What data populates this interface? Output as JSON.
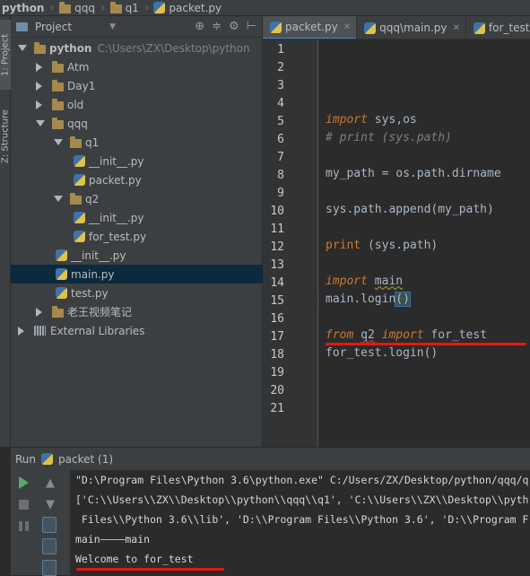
{
  "breadcrumb": {
    "items": [
      "python",
      "qqq",
      "q1",
      "packet.py"
    ]
  },
  "left_stripe": {
    "project_label": "1: Project",
    "structure_label": "Z: Structure"
  },
  "project_panel": {
    "title": "Project",
    "tree": [
      {
        "label": "python",
        "path": "C:\\Users\\ZX\\Desktop\\python",
        "type": "folder",
        "state": "open",
        "depth": 0
      },
      {
        "label": "Atm",
        "type": "folder",
        "state": "closed",
        "depth": 1
      },
      {
        "label": "Day1",
        "type": "folder",
        "state": "closed",
        "depth": 1
      },
      {
        "label": "old",
        "type": "folder",
        "state": "closed",
        "depth": 1
      },
      {
        "label": "qqq",
        "type": "folder",
        "state": "open",
        "depth": 1
      },
      {
        "label": "q1",
        "type": "folder",
        "state": "open",
        "depth": 2
      },
      {
        "label": "__init__.py",
        "type": "py",
        "depth": 3
      },
      {
        "label": "packet.py",
        "type": "py",
        "depth": 3
      },
      {
        "label": "q2",
        "type": "folder",
        "state": "open",
        "depth": 2
      },
      {
        "label": "__init__.py",
        "type": "py",
        "depth": 3
      },
      {
        "label": "for_test.py",
        "type": "py",
        "depth": 3
      },
      {
        "label": "__init__.py",
        "type": "py",
        "depth": 2
      },
      {
        "label": "main.py",
        "type": "py",
        "depth": 2,
        "selected": true
      },
      {
        "label": "test.py",
        "type": "py",
        "depth": 2
      },
      {
        "label": "老王视频笔记",
        "type": "folder",
        "state": "closed",
        "depth": 1
      },
      {
        "label": "External Libraries",
        "type": "lib",
        "state": "closed",
        "depth": 0
      }
    ]
  },
  "editor": {
    "tabs": [
      {
        "label": "packet.py",
        "active": true
      },
      {
        "label": "qqq\\main.py",
        "active": false
      },
      {
        "label": "for_test",
        "active": false
      }
    ],
    "line_numbers": [
      "1",
      "2",
      "3",
      "4",
      "5",
      "6",
      "7",
      "8",
      "9",
      "10",
      "11",
      "12",
      "13",
      "14",
      "15",
      "16",
      "17",
      "18",
      "19",
      "20",
      "21"
    ],
    "current_line": 15,
    "code": {
      "l5_kw": "import",
      "l5_rest": " sys,os",
      "l6_comment": "# print (sys.path)",
      "l8": "my_path = os.path.dirname",
      "l10": "sys.path.append(my_path)",
      "l12_kw": "print",
      "l12_rest": " (sys.path)",
      "l14_kw": "import",
      "l14_mod": "main",
      "l15_a": "main.login",
      "l15_paren": "()",
      "l17_from": "from",
      "l17_mod": "q2",
      "l17_import": "import",
      "l17_name": "for_test",
      "l18": "for_test.login()"
    }
  },
  "run_panel": {
    "label": "Run",
    "config": "packet (1)",
    "output": [
      "\"D:\\Program Files\\Python 3.6\\python.exe\" C:/Users/ZX/Desktop/python/qqq/q",
      "['C:\\\\Users\\\\ZX\\\\Desktop\\\\python\\\\qqq\\\\q1', 'C:\\\\Users\\\\ZX\\\\Desktop\\\\pyth",
      " Files\\\\Python 3.6\\\\lib', 'D:\\\\Program Files\\\\Python 3.6', 'D:\\\\Program F",
      "main————main",
      "Welcome to for_test"
    ]
  },
  "colors": {
    "accent": "#4a88c7",
    "keyword": "#cc7832",
    "selection": "#0d293e",
    "annotation_red": "#e8170e"
  }
}
